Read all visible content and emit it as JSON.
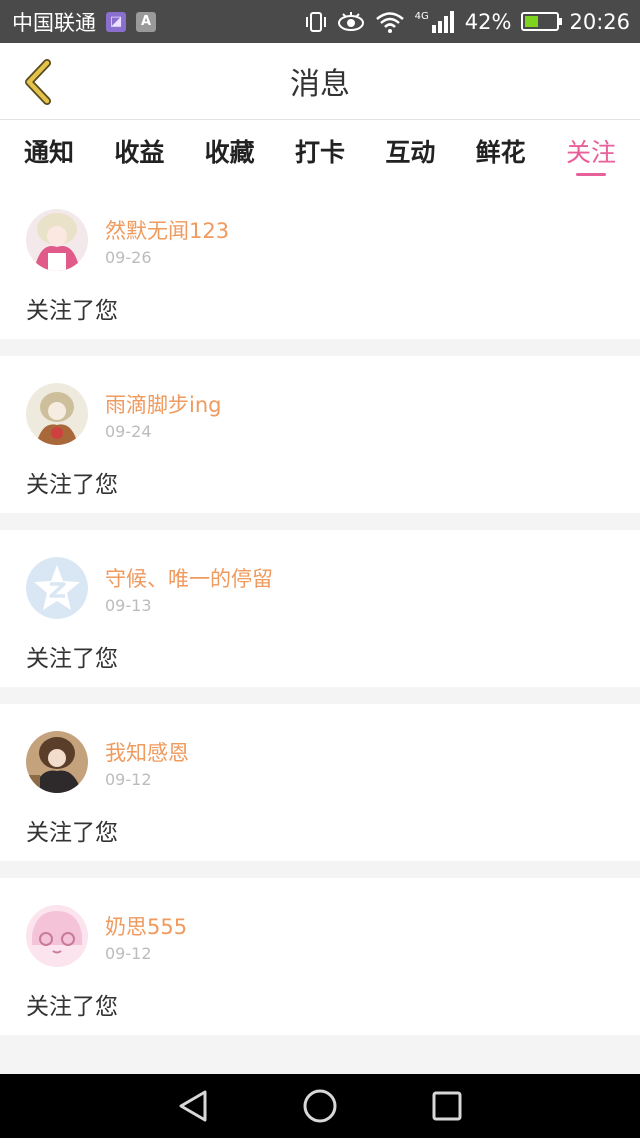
{
  "status_bar": {
    "carrier": "中国联通",
    "app_icon_1": "◪",
    "app_icon_2": "A",
    "network": "4G",
    "battery": "42%",
    "time": "20:26"
  },
  "header": {
    "title": "消息",
    "back_icon": "chevron-left-icon"
  },
  "tabs": [
    {
      "label": "通知",
      "active": false
    },
    {
      "label": "收益",
      "active": false
    },
    {
      "label": "收藏",
      "active": false
    },
    {
      "label": "打卡",
      "active": false
    },
    {
      "label": "互动",
      "active": false
    },
    {
      "label": "鲜花",
      "active": false
    },
    {
      "label": "关注",
      "active": true
    }
  ],
  "messages": [
    {
      "user": "然默无闻123",
      "date": "09-26",
      "text": "关注了您"
    },
    {
      "user": "雨滴脚步ing",
      "date": "09-24",
      "text": "关注了您"
    },
    {
      "user": "守候、唯一的停留",
      "date": "09-13",
      "text": "关注了您"
    },
    {
      "user": "我知感恩",
      "date": "09-12",
      "text": "关注了您"
    },
    {
      "user": "奶思555",
      "date": "09-12",
      "text": "关注了您"
    }
  ],
  "colors": {
    "accent": "#e8609a",
    "username": "#ef9a5e",
    "back_arrow": "#e3c34a",
    "status_bar": "#4a4a4a"
  }
}
